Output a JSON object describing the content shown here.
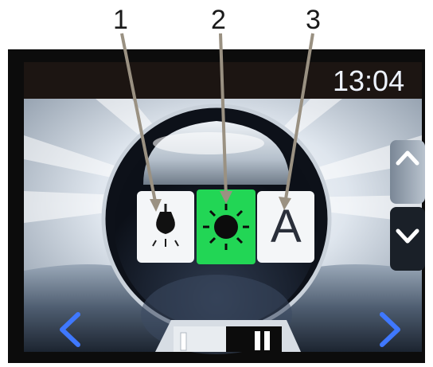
{
  "callouts": [
    "1",
    "2",
    "3"
  ],
  "status_bar": {
    "time": "13:04"
  },
  "mode_buttons": [
    {
      "icon": "bulb-icon",
      "selected": false
    },
    {
      "icon": "sun-icon",
      "selected": true
    },
    {
      "label": "A",
      "selected": false
    }
  ],
  "scroll_buttons": {
    "up_icon": "chevron-up-icon",
    "down_icon": "chevron-down-icon"
  },
  "nav_buttons": {
    "prev_icon": "chevron-left-icon",
    "next_icon": "chevron-right-icon"
  },
  "toggle": {
    "options": [
      "I",
      "II"
    ],
    "selected": "II"
  },
  "colors": {
    "selected": "#22d655",
    "button": "#f4f6f8",
    "nav_arrow": "#3f78ff",
    "screen_frame": "#0c0c0c",
    "callout_line": "#9a9182"
  }
}
